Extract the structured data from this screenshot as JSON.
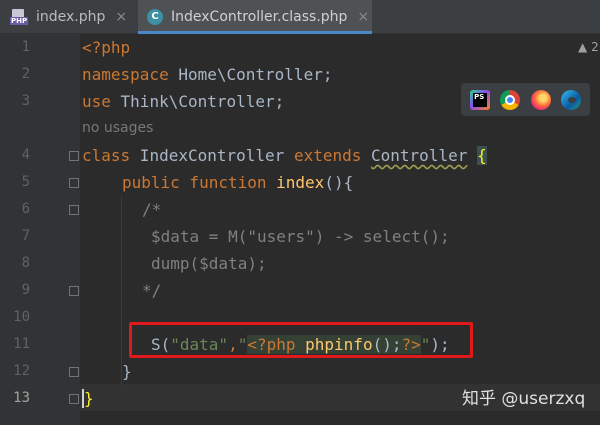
{
  "tabs": [
    {
      "label": "index.php",
      "icon": "php-file-icon",
      "icon_tag": "PHP",
      "active": false
    },
    {
      "label": "IndexController.class.php",
      "icon": "class-file-icon",
      "icon_letter": "C",
      "active": true
    }
  ],
  "close_glyph": "×",
  "warning": {
    "icon": "warning-icon",
    "glyph": "▲",
    "count": "2"
  },
  "browser_popup": {
    "icons": [
      "phpstorm-icon",
      "chrome-icon",
      "firefox-icon",
      "edge-icon"
    ],
    "ps_label": "PS"
  },
  "editor": {
    "current_line": 13,
    "line_numbers": [
      "1",
      "2",
      "3",
      "4",
      "5",
      "6",
      "7",
      "8",
      "9",
      "10",
      "11",
      "12",
      "13"
    ],
    "usage_hint": "no usages",
    "code": {
      "l1": "<?php",
      "l2_kw": "namespace",
      "l2_ns": " Home\\Controller;",
      "l3_kw": "use",
      "l3_ns": " Think\\Controller;",
      "l4_kw1": "class",
      "l4_name": " IndexController ",
      "l4_kw2": "extends",
      "l4_sp": " ",
      "l4_parent": "Controller",
      "l4_brace": "{",
      "l5_kw": "public function",
      "l5_fn": "index",
      "l5_rest": "(){",
      "l6": "/*",
      "l7": "$data = M(\"users\") -> select();",
      "l8": "dump($data);",
      "l9": "*/",
      "l11_fn": "S(",
      "l11_str1": "\"data\"",
      "l11_comma": ",",
      "l11_q": "\"",
      "l11_php": "<?php ",
      "l11_phpinfo": "phpinfo",
      "l11_parens": "();",
      "l11_close": "?>",
      "l11_q2": "\"",
      "l11_end": ");",
      "l12": "}",
      "l13": "}"
    }
  },
  "watermark": "知乎 @userzxq",
  "colors": {
    "keyword": "#cc7832",
    "function": "#ffc66d",
    "string": "#6a8759",
    "comment": "#808080",
    "highlight_box": "#e0191b"
  }
}
